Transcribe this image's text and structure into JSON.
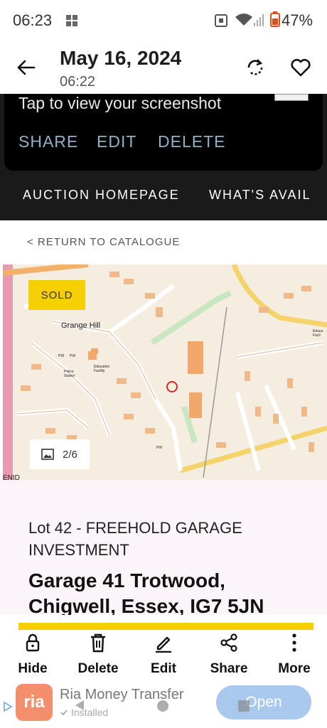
{
  "status": {
    "time": "06:23",
    "battery": "47%"
  },
  "header": {
    "title": "May 16, 2024",
    "subtitle": "06:22"
  },
  "toast": {
    "message": "Tap to view your screenshot",
    "share": "SHARE",
    "edit": "EDIT",
    "delete": "DELETE"
  },
  "site_nav": {
    "items": [
      "AUCTION HOMEPAGE",
      "WHAT'S AVAIL"
    ]
  },
  "catalogue": {
    "return_label": "< RETURN TO CATALOGUE"
  },
  "map": {
    "sold_badge": "SOLD",
    "photo_counter": "2/6",
    "place_labels": [
      "Grange Hill",
      "Police Station",
      "Education Facility",
      "PW",
      "PW",
      "PW",
      "Educa Facil",
      "ENID"
    ]
  },
  "lot": {
    "lot_line": "Lot 42 - FREEHOLD GARAGE INVESTMENT",
    "address": "Garage 41 Trotwood, Chigwell, Essex, IG7 5JN"
  },
  "actions": {
    "hide": "Hide",
    "delete": "Delete",
    "edit": "Edit",
    "share": "Share",
    "more": "More"
  },
  "ad": {
    "logo": "ria",
    "title": "Ria Money Transfer",
    "subtitle": "Installed",
    "button": "Open"
  },
  "colors": {
    "accent_yellow": "#f5cf00",
    "toast_action": "#8fb1c9",
    "ad_button": "#a8c8ee"
  }
}
